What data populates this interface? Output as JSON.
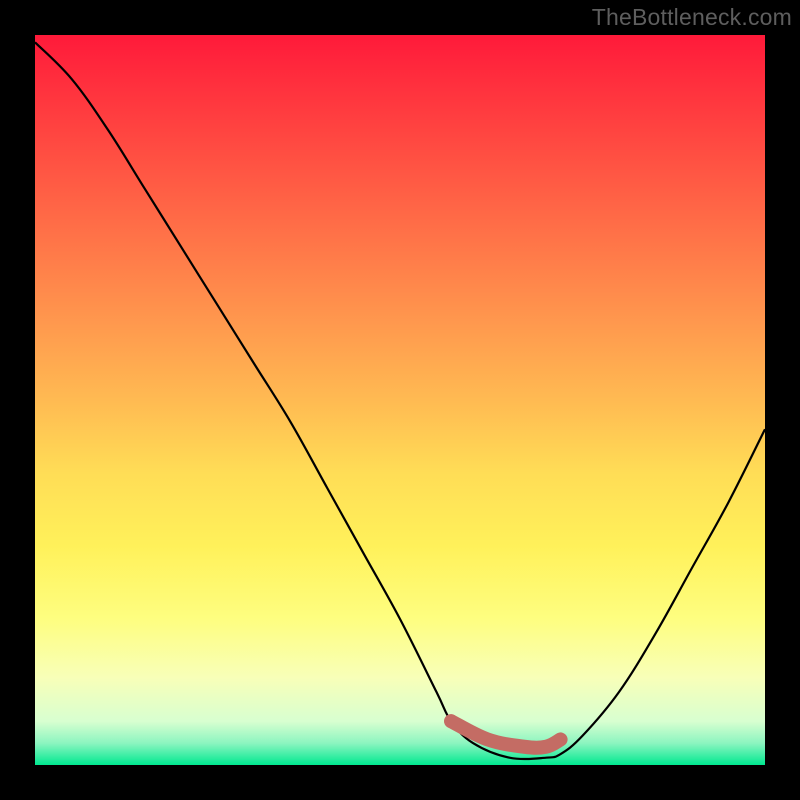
{
  "watermark": "TheBottleneck.com",
  "colors": {
    "background": "#000000",
    "curve": "#000000",
    "marker": "#c46c64",
    "gradient_top": "#ff1a3a",
    "gradient_bottom": "#00e890"
  },
  "chart_data": {
    "type": "line",
    "title": "",
    "xlabel": "",
    "ylabel": "",
    "xlim": [
      0,
      100
    ],
    "ylim": [
      0,
      100
    ],
    "grid": false,
    "series": [
      {
        "name": "bottleneck-curve",
        "x": [
          0,
          5,
          10,
          15,
          20,
          25,
          30,
          35,
          40,
          45,
          50,
          55,
          57,
          60,
          65,
          70,
          72,
          75,
          80,
          85,
          90,
          95,
          100
        ],
        "y": [
          99,
          94,
          87,
          79,
          71,
          63,
          55,
          47,
          38,
          29,
          20,
          10,
          6,
          3,
          1,
          1,
          1.5,
          4,
          10,
          18,
          27,
          36,
          46
        ]
      }
    ],
    "highlight_segment": {
      "name": "optimal-range",
      "x": [
        57,
        62,
        67,
        70,
        72
      ],
      "y": [
        6,
        3.5,
        2.5,
        2.5,
        3.5
      ]
    }
  }
}
